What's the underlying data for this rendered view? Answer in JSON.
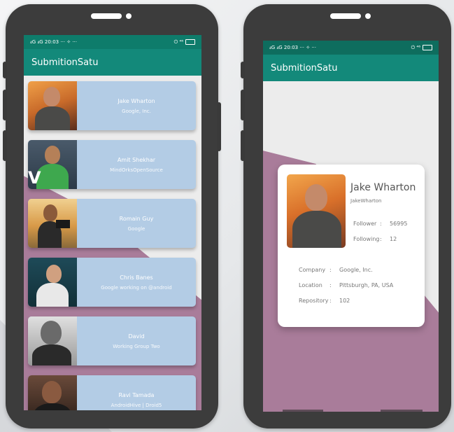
{
  "app": {
    "title": "SubmitionSatu"
  },
  "status_left": {
    "signal": "₄G ₄G",
    "time": "20:03",
    "extra": "··· ✧ ···"
  },
  "status_right": {
    "icons": "⏻ ⁴⁶"
  },
  "users": [
    {
      "name": "Jake Wharton",
      "company": "Google, Inc."
    },
    {
      "name": "Amit Shekhar",
      "company": "MindOrksOpenSource"
    },
    {
      "name": "Romain Guy",
      "company": "Google"
    },
    {
      "name": "Chris Banes",
      "company": "Google working on @android"
    },
    {
      "name": "David",
      "company": "Working Group Two"
    },
    {
      "name": "Ravi Tamada",
      "company": "AndroidHive | Droid5"
    }
  ],
  "detail": {
    "name": "Jake Wharton",
    "username": "JakeWharton",
    "follower_label": "Follower",
    "follower_value": "56995",
    "following_label": "Following",
    "following_value": "12",
    "company_label": "Company",
    "company_value": "Google, Inc.",
    "location_label": "Location",
    "location_value": "Pittsburgh, PA, USA",
    "repository_label": "Repository",
    "repository_value": "102",
    "colon": ":"
  },
  "colors": {
    "primary": "#13897a",
    "primary_dark": "#0e7c6b",
    "card": "#b3cce5",
    "accent_shape": "#a97c9a"
  }
}
